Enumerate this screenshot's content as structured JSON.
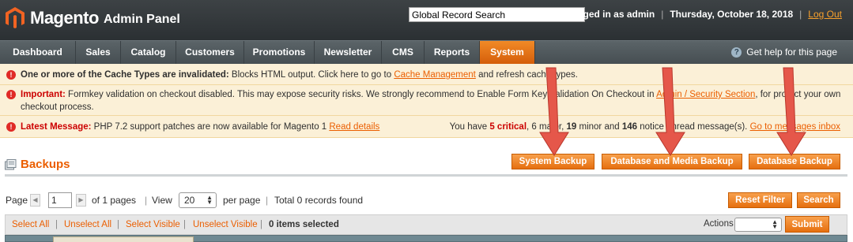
{
  "header": {
    "logo_text": "Magento",
    "logo_sub": "Admin Panel",
    "search_value": "Global Record Search",
    "logged_in": "Logged in as admin",
    "date": "Thursday, October 18, 2018",
    "logout": "Log Out"
  },
  "nav": {
    "items": [
      "Dashboard",
      "Sales",
      "Catalog",
      "Customers",
      "Promotions",
      "Newsletter",
      "CMS",
      "Reports",
      "System"
    ],
    "active": "System",
    "help": "Get help for this page"
  },
  "messages": {
    "cache": {
      "bold": "One or more of the Cache Types are invalidated:",
      "text": " Blocks HTML output. Click here to go to ",
      "link": "Cache Management",
      "tail": " and refresh cache types."
    },
    "formkey": {
      "bold": "Important:",
      "text": " Formkey validation on checkout disabled. This may expose security risks. We strongly recommend to Enable Form Key Validation On Checkout in ",
      "link": "Admin / Security Section",
      "tail": ", for protect your own checkout process."
    },
    "latest": {
      "bold": "Latest Message:",
      "text": " PHP 7.2 support patches are now available for Magento 1 ",
      "link": "Read details",
      "summary_pre": "You have ",
      "critical": "5 critical",
      "summary_mid": ", 6 major, ",
      "minor": "19",
      "summary_mid2": " minor and ",
      "notice": "146",
      "summary_post": " notice unread message(s). ",
      "inbox_link": "Go to messages inbox"
    }
  },
  "page": {
    "title": "Backups",
    "buttons": {
      "system_backup": "System Backup",
      "db_media_backup": "Database and Media Backup",
      "db_backup": "Database Backup"
    }
  },
  "pager": {
    "page_label": "Page",
    "page_value": "1",
    "of_pages": "of 1 pages",
    "view_label": "View",
    "per_page_value": "20",
    "per_page_label": "per page",
    "total": "Total 0 records found",
    "reset_filter": "Reset Filter",
    "search": "Search"
  },
  "massaction": {
    "select_all": "Select All",
    "unselect_all": "Unselect All",
    "select_visible": "Select Visible",
    "unselect_visible": "Unselect Visible",
    "selected": "0 items selected",
    "actions_label": "Actions",
    "submit": "Submit"
  },
  "colors": {
    "accent": "#eb5e00",
    "nav_active": "#e4710f",
    "annotation_arrow": "#e5574a"
  }
}
